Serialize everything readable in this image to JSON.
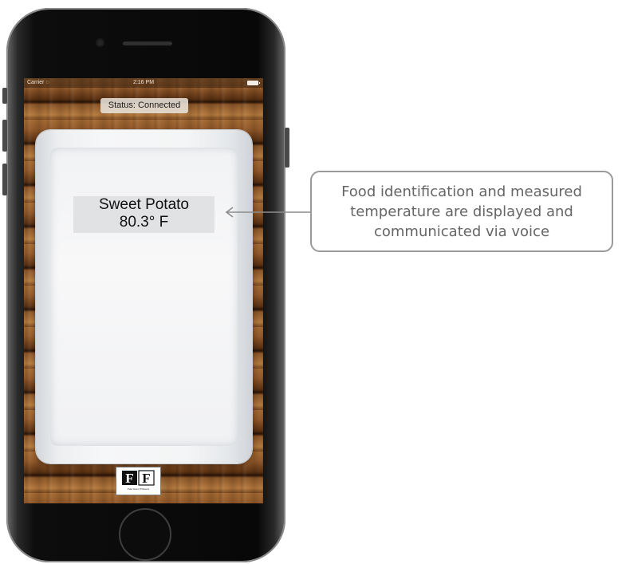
{
  "status_bar": {
    "carrier": "Carrier",
    "wifi_icon": "wifi-icon",
    "time": "2:16 PM",
    "battery_icon": "battery-icon"
  },
  "status_pill": "Status: Connected",
  "food": {
    "name": "Sweet Potato",
    "temperature": "80.3° F"
  },
  "logo": {
    "letters": "FF",
    "tagline": "Functional Fixtures"
  },
  "callout": {
    "lines": [
      "Food identification and measured",
      "temperature are displayed and",
      "communicated via voice"
    ]
  },
  "colors": {
    "callout_border": "#9a9a9a",
    "callout_text": "#666666",
    "arrow": "#8c8c8c",
    "wood": "#8a5428"
  }
}
